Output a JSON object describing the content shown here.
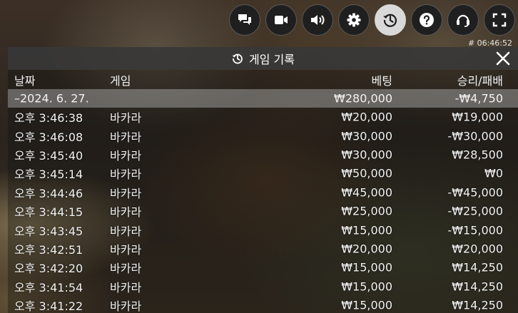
{
  "toolbar": {
    "buttons": [
      {
        "icon": "chat-icon",
        "active": false
      },
      {
        "icon": "video-camera-icon",
        "active": false
      },
      {
        "icon": "speaker-icon",
        "active": false
      },
      {
        "icon": "gear-icon",
        "active": false
      },
      {
        "icon": "history-icon",
        "active": true
      },
      {
        "icon": "help-icon",
        "active": false
      },
      {
        "icon": "headset-icon",
        "active": false
      },
      {
        "icon": "fullscreen-icon",
        "active": false
      }
    ]
  },
  "clock": "# 06:46:52",
  "panel": {
    "title": "게임 기록",
    "columns": {
      "date": "날짜",
      "game": "게임",
      "bet": "베팅",
      "winloss": "승리/패배"
    },
    "summary": {
      "date": "–2024. 6. 27.",
      "bet": "₩280,000",
      "winloss": "-₩4,750"
    },
    "rows": [
      {
        "time": "오후 3:46:38",
        "game": "바카라",
        "bet": "₩20,000",
        "winloss": "₩19,000"
      },
      {
        "time": "오후 3:46:08",
        "game": "바카라",
        "bet": "₩30,000",
        "winloss": "-₩30,000"
      },
      {
        "time": "오후 3:45:40",
        "game": "바카라",
        "bet": "₩30,000",
        "winloss": "₩28,500"
      },
      {
        "time": "오후 3:45:14",
        "game": "바카라",
        "bet": "₩50,000",
        "winloss": "₩0"
      },
      {
        "time": "오후 3:44:46",
        "game": "바카라",
        "bet": "₩45,000",
        "winloss": "-₩45,000"
      },
      {
        "time": "오후 3:44:15",
        "game": "바카라",
        "bet": "₩25,000",
        "winloss": "-₩25,000"
      },
      {
        "time": "오후 3:43:45",
        "game": "바카라",
        "bet": "₩15,000",
        "winloss": "-₩15,000"
      },
      {
        "time": "오후 3:42:51",
        "game": "바카라",
        "bet": "₩20,000",
        "winloss": "₩20,000"
      },
      {
        "time": "오후 3:42:20",
        "game": "바카라",
        "bet": "₩15,000",
        "winloss": "₩14,250"
      },
      {
        "time": "오후 3:41:54",
        "game": "바카라",
        "bet": "₩15,000",
        "winloss": "₩14,250"
      },
      {
        "time": "오후 3:41:22",
        "game": "바카라",
        "bet": "₩15,000",
        "winloss": "₩14,250"
      }
    ]
  }
}
